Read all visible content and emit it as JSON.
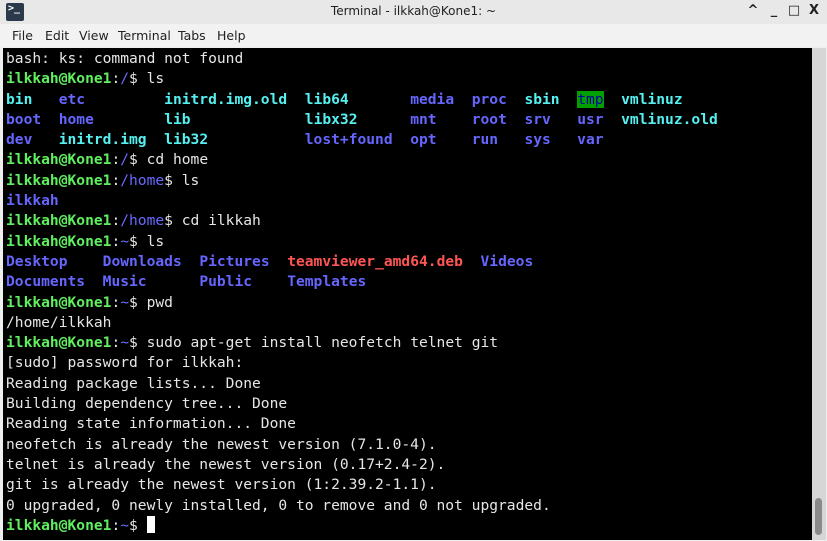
{
  "window": {
    "title": "Terminal - ilkkah@Kone1: ~",
    "icon": "terminal-icon",
    "controls": [
      "^",
      "_",
      "□",
      "X"
    ]
  },
  "menu": [
    "File",
    "Edit",
    "View",
    "Terminal",
    "Tabs",
    "Help"
  ],
  "colors": {
    "prompt": "#5ff05f",
    "path": "#6a6aff",
    "directory": "#6666ff",
    "symlink": "#55f0f0",
    "archive": "#ff5555",
    "sticky_dir_bg": "#00a000"
  },
  "terminal": {
    "lines": [
      [
        {
          "t": "bash: ks: command not found"
        }
      ],
      [
        {
          "t": "ilkkah@Kone1",
          "c": "g"
        },
        {
          "t": ":"
        },
        {
          "t": "/",
          "c": "b"
        },
        {
          "t": "$ ls"
        }
      ],
      [
        {
          "t": "bin",
          "c": "c"
        },
        {
          "t": "   "
        },
        {
          "t": "etc",
          "c": "bb"
        },
        {
          "t": "         "
        },
        {
          "t": "initrd.img.old",
          "c": "c"
        },
        {
          "t": "  "
        },
        {
          "t": "lib64",
          "c": "c"
        },
        {
          "t": "       "
        },
        {
          "t": "media",
          "c": "bb"
        },
        {
          "t": "  "
        },
        {
          "t": "proc",
          "c": "bb"
        },
        {
          "t": "  "
        },
        {
          "t": "sbin",
          "c": "c"
        },
        {
          "t": "  "
        },
        {
          "t": "tmp",
          "c": "tmp"
        },
        {
          "t": "  "
        },
        {
          "t": "vmlinuz",
          "c": "c"
        }
      ],
      [
        {
          "t": "boot",
          "c": "bb"
        },
        {
          "t": "  "
        },
        {
          "t": "home",
          "c": "bb"
        },
        {
          "t": "        "
        },
        {
          "t": "lib",
          "c": "c"
        },
        {
          "t": "             "
        },
        {
          "t": "libx32",
          "c": "c"
        },
        {
          "t": "      "
        },
        {
          "t": "mnt",
          "c": "bb"
        },
        {
          "t": "    "
        },
        {
          "t": "root",
          "c": "bb"
        },
        {
          "t": "  "
        },
        {
          "t": "srv",
          "c": "bb"
        },
        {
          "t": "   "
        },
        {
          "t": "usr",
          "c": "bb"
        },
        {
          "t": "  "
        },
        {
          "t": "vmlinuz.old",
          "c": "c"
        }
      ],
      [
        {
          "t": "dev",
          "c": "bb"
        },
        {
          "t": "   "
        },
        {
          "t": "initrd.img",
          "c": "c"
        },
        {
          "t": "  "
        },
        {
          "t": "lib32",
          "c": "c"
        },
        {
          "t": "           "
        },
        {
          "t": "lost+found",
          "c": "bb"
        },
        {
          "t": "  "
        },
        {
          "t": "opt",
          "c": "bb"
        },
        {
          "t": "    "
        },
        {
          "t": "run",
          "c": "bb"
        },
        {
          "t": "   "
        },
        {
          "t": "sys",
          "c": "bb"
        },
        {
          "t": "   "
        },
        {
          "t": "var",
          "c": "bb"
        }
      ],
      [
        {
          "t": "ilkkah@Kone1",
          "c": "g"
        },
        {
          "t": ":"
        },
        {
          "t": "/",
          "c": "b"
        },
        {
          "t": "$ cd home"
        }
      ],
      [
        {
          "t": "ilkkah@Kone1",
          "c": "g"
        },
        {
          "t": ":"
        },
        {
          "t": "/home",
          "c": "b"
        },
        {
          "t": "$ ls"
        }
      ],
      [
        {
          "t": "ilkkah",
          "c": "bb"
        }
      ],
      [
        {
          "t": "ilkkah@Kone1",
          "c": "g"
        },
        {
          "t": ":"
        },
        {
          "t": "/home",
          "c": "b"
        },
        {
          "t": "$ cd ilkkah"
        }
      ],
      [
        {
          "t": "ilkkah@Kone1",
          "c": "g"
        },
        {
          "t": ":"
        },
        {
          "t": "~",
          "c": "b"
        },
        {
          "t": "$ ls"
        }
      ],
      [
        {
          "t": "Desktop",
          "c": "bb"
        },
        {
          "t": "    "
        },
        {
          "t": "Downloads",
          "c": "bb"
        },
        {
          "t": "  "
        },
        {
          "t": "Pictures",
          "c": "bb"
        },
        {
          "t": "  "
        },
        {
          "t": "teamviewer_amd64.deb",
          "c": "r"
        },
        {
          "t": "  "
        },
        {
          "t": "Videos",
          "c": "bb"
        }
      ],
      [
        {
          "t": "Documents",
          "c": "bb"
        },
        {
          "t": "  "
        },
        {
          "t": "Music",
          "c": "bb"
        },
        {
          "t": "      "
        },
        {
          "t": "Public",
          "c": "bb"
        },
        {
          "t": "    "
        },
        {
          "t": "Templates",
          "c": "bb"
        }
      ],
      [
        {
          "t": "ilkkah@Kone1",
          "c": "g"
        },
        {
          "t": ":"
        },
        {
          "t": "~",
          "c": "b"
        },
        {
          "t": "$ pwd"
        }
      ],
      [
        {
          "t": "/home/ilkkah"
        }
      ],
      [
        {
          "t": "ilkkah@Kone1",
          "c": "g"
        },
        {
          "t": ":"
        },
        {
          "t": "~",
          "c": "b"
        },
        {
          "t": "$ sudo apt-get install neofetch telnet git"
        }
      ],
      [
        {
          "t": "[sudo] password for ilkkah:"
        }
      ],
      [
        {
          "t": "Reading package lists... Done"
        }
      ],
      [
        {
          "t": "Building dependency tree... Done"
        }
      ],
      [
        {
          "t": "Reading state information... Done"
        }
      ],
      [
        {
          "t": "neofetch is already the newest version (7.1.0-4)."
        }
      ],
      [
        {
          "t": "telnet is already the newest version (0.17+2.4-2)."
        }
      ],
      [
        {
          "t": "git is already the newest version (1:2.39.2-1.1)."
        }
      ],
      [
        {
          "t": "0 upgraded, 0 newly installed, 0 to remove and 0 not upgraded."
        }
      ],
      [
        {
          "t": "ilkkah@Kone1",
          "c": "g"
        },
        {
          "t": ":"
        },
        {
          "t": "~",
          "c": "b"
        },
        {
          "t": "$ "
        }
      ]
    ]
  }
}
